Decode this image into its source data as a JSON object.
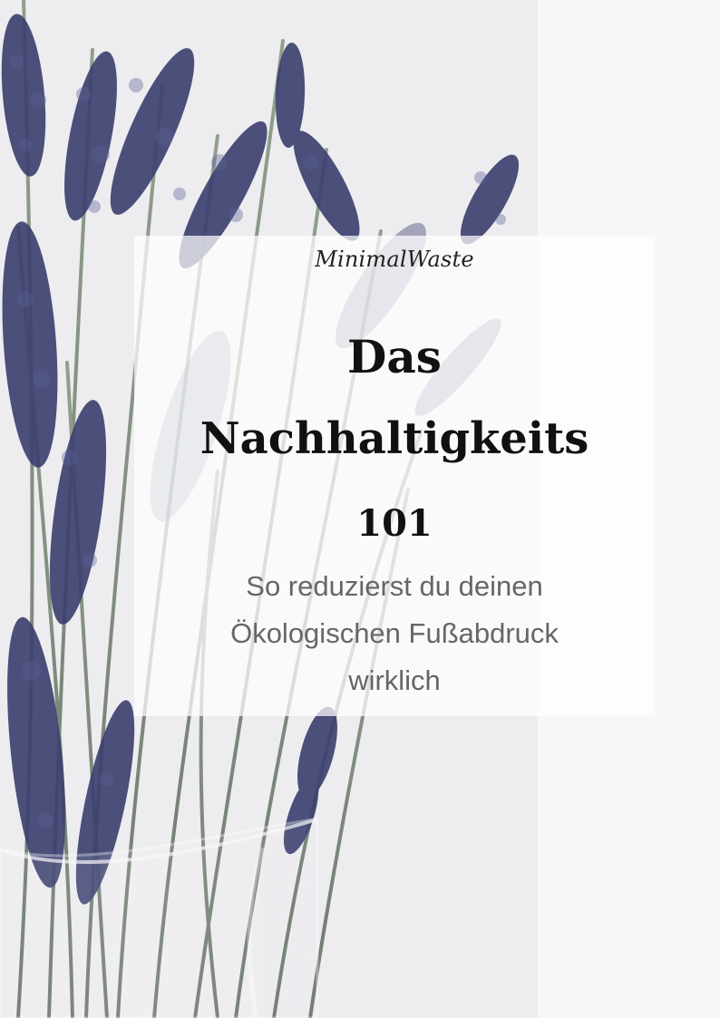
{
  "document": {
    "brand": "MinimalWaste",
    "title": {
      "line1": "Das",
      "line2": "Nachhaltigkeits",
      "line3": "101"
    },
    "subtitle": {
      "line1": "So reduzierst du deinen",
      "line2": "Ökologischen Fußabdruck",
      "line3": "wirklich"
    }
  },
  "colors": {
    "background": "#f4f4f5",
    "lavender": "#3f4470",
    "stem": "#8a9b7f",
    "card": "#ffffff",
    "title": "#111111",
    "subtitle": "#666666"
  },
  "image": {
    "subject": "lavender bouquet in a clear glass vase",
    "overlay": "translucent white text panel"
  }
}
